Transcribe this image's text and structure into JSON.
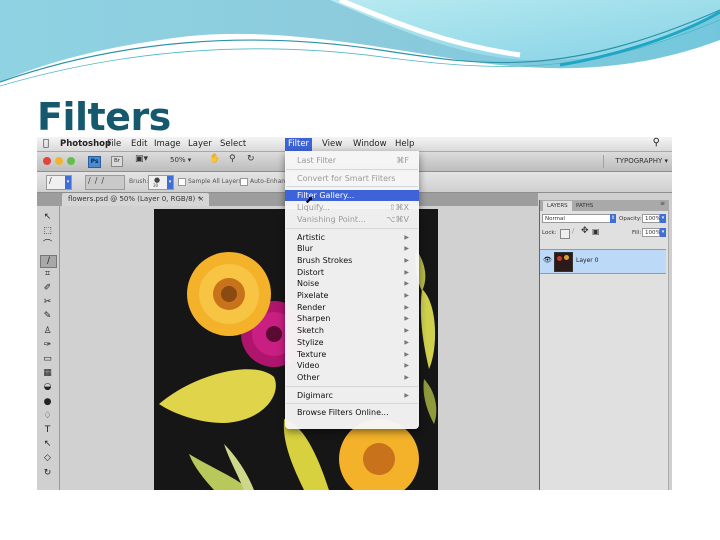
{
  "slide": {
    "title": "Filters",
    "theme_colors": {
      "title": "#16596f",
      "wave_light": "#a6e0ea",
      "wave_dark": "#6fc0d6",
      "wave_line": "#2e93a8"
    }
  },
  "menubar": {
    "apple": "",
    "app_name": "Photoshop",
    "items": [
      "File",
      "Edit",
      "Image",
      "Layer",
      "Select",
      "Filter",
      "View",
      "Window",
      "Help"
    ],
    "active_item": "Filter",
    "spotlight": "search-icon"
  },
  "appbar": {
    "ps_badge": "Ps",
    "br_badge": "Br",
    "zoom": "50%",
    "workspace": "TYPOGRAPHY ▾"
  },
  "options_bar": {
    "brush_label": "Brush:",
    "brush_size": "30",
    "sample_all_layers": "Sample All Layers",
    "auto_enhance": "Auto-Enhance"
  },
  "document_tab": {
    "title": "flowers.psd @ 50% (Layer 0, RGB/8) *",
    "close": "×"
  },
  "filter_menu": {
    "items": [
      {
        "label": "Last Filter",
        "shortcut": "⌘F",
        "disabled": true
      },
      {
        "separator": true
      },
      {
        "label": "Convert for Smart Filters",
        "disabled": true
      },
      {
        "separator": true
      },
      {
        "label": "Filter Gallery...",
        "highlighted": true
      },
      {
        "label": "Liquify...",
        "shortcut": "⇧⌘X",
        "disabled": true
      },
      {
        "label": "Vanishing Point...",
        "shortcut": "⌥⌘V",
        "disabled": true
      },
      {
        "separator": true
      },
      {
        "label": "Artistic",
        "submenu": true
      },
      {
        "label": "Blur",
        "submenu": true
      },
      {
        "label": "Brush Strokes",
        "submenu": true
      },
      {
        "label": "Distort",
        "submenu": true
      },
      {
        "label": "Noise",
        "submenu": true
      },
      {
        "label": "Pixelate",
        "submenu": true
      },
      {
        "label": "Render",
        "submenu": true
      },
      {
        "label": "Sharpen",
        "submenu": true
      },
      {
        "label": "Sketch",
        "submenu": true
      },
      {
        "label": "Stylize",
        "submenu": true
      },
      {
        "label": "Texture",
        "submenu": true
      },
      {
        "label": "Video",
        "submenu": true
      },
      {
        "label": "Other",
        "submenu": true
      },
      {
        "separator": true
      },
      {
        "label": "Digimarc",
        "submenu": true
      },
      {
        "separator": true
      },
      {
        "label": "Browse Filters Online..."
      }
    ]
  },
  "layers_panel": {
    "tabs": [
      "LAYERS",
      "PATHS"
    ],
    "active_tab": "LAYERS",
    "blend_mode": "Normal",
    "opacity_label": "Opacity:",
    "opacity": "100%",
    "lock_label": "Lock:",
    "fill_label": "Fill:",
    "fill": "100%",
    "layers": [
      {
        "name": "Layer 0",
        "selected": true
      }
    ]
  },
  "tools": [
    "move-tool",
    "marquee-tool",
    "lasso-tool",
    "quick-selection-tool",
    "crop-tool",
    "eyedropper-tool",
    "healing-brush-tool",
    "brush-tool",
    "clone-stamp-tool",
    "history-brush-tool",
    "eraser-tool",
    "gradient-tool",
    "blur-tool",
    "dodge-tool",
    "pen-tool",
    "type-tool",
    "path-selection-tool",
    "shape-tool",
    "3d-rotate-tool"
  ],
  "tool_glyphs": [
    "↖",
    "⬚",
    "⌒",
    "∕",
    "⌗",
    "✐",
    "✂",
    "✎",
    "♙",
    "✑",
    "▭",
    "▦",
    "◒",
    "●",
    "♢",
    "T",
    "↖",
    "◇",
    "↻"
  ],
  "selected_tool": "quick-selection-tool"
}
